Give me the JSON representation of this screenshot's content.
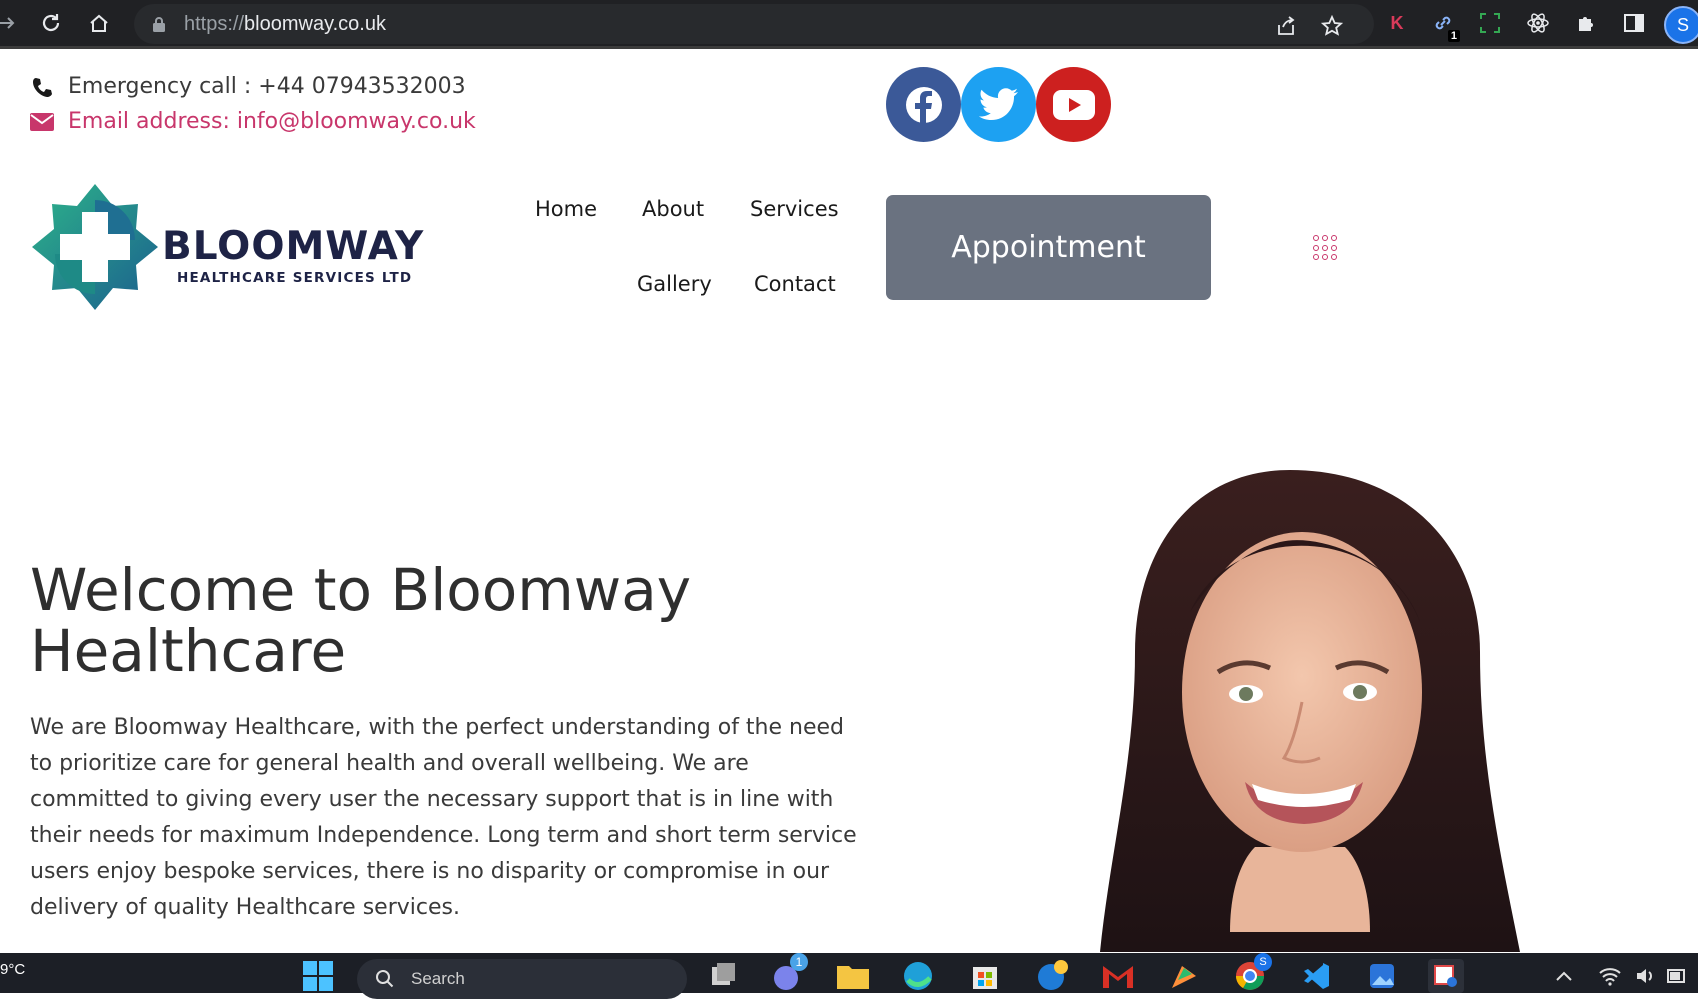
{
  "browser": {
    "url_scheme": "https://",
    "url_host": "bloomway.co.uk",
    "extension_badge": "1",
    "profile_initial": "S",
    "extension_k": "K"
  },
  "contact": {
    "phone": "Emergency call : +44 07943532003",
    "email": "Email address: info@bloomway.co.uk"
  },
  "social": [
    "facebook",
    "twitter",
    "youtube"
  ],
  "logo": {
    "title": "BLOOMWAY",
    "subtitle": "HEALTHCARE SERVICES LTD"
  },
  "nav": {
    "home": "Home",
    "about": "About",
    "services": "Services",
    "gallery": "Gallery",
    "contact": "Contact"
  },
  "appointment_label": "Appointment",
  "hero": {
    "title": "Welcome to Bloomway Healthcare",
    "text": "We are Bloomway Healthcare, with the perfect understanding of the need to prioritize care for general health and overall wellbeing. We are committed to giving every user the necessary support that is in line with their needs for maximum Independence. Long term and short term service users enjoy bespoke services, there is no disparity or compromise in our delivery of quality Healthcare services."
  },
  "taskbar": {
    "temperature": "9°C",
    "search_placeholder": "Search",
    "teams_badge": "1",
    "chrome_badge": "S"
  },
  "colors": {
    "accent": "#c8366b",
    "appointment_bg": "#6a7280",
    "facebook": "#3b5998",
    "twitter": "#1da1f2",
    "youtube": "#cd201f",
    "logo_navy": "#1e2346"
  }
}
